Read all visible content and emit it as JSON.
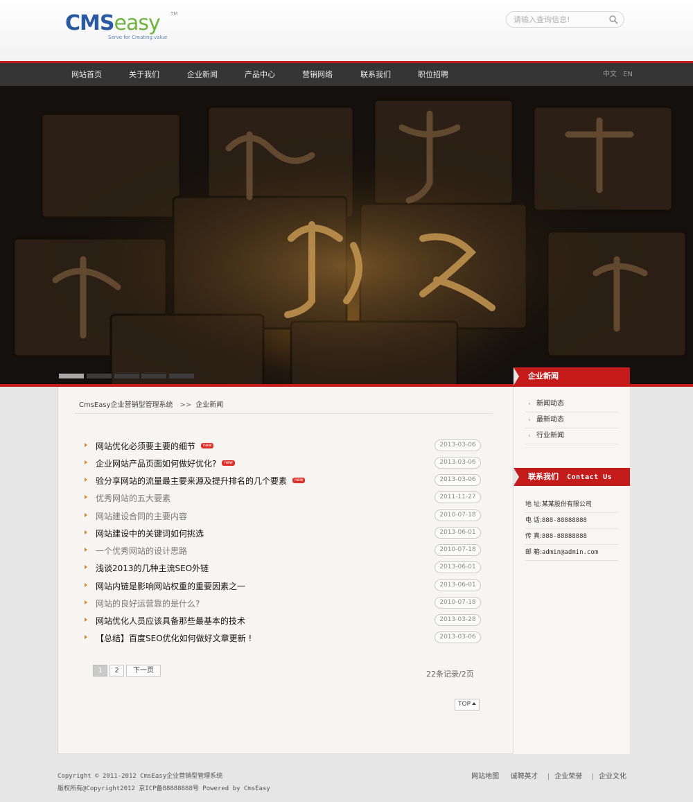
{
  "logo": {
    "cms": "CMS",
    "easy": "easy",
    "tm": "TM",
    "tagline": "Serve for Creating value"
  },
  "search": {
    "placeholder": "请输入查询信息!"
  },
  "nav": {
    "items": [
      "网站首页",
      "关于我们",
      "企业新闻",
      "产品中心",
      "营销网络",
      "联系我们",
      "职位招聘"
    ],
    "lang_cn": "中文",
    "lang_en": "EN"
  },
  "breadcrumb": {
    "site": "CmsEasy企业营销型管理系统",
    "sep": ">>",
    "current": "企业新闻"
  },
  "news": [
    {
      "title": "网站优化必须要主要的细节",
      "date": "2013-03-06",
      "is_new": true,
      "new_label": "new",
      "light": false
    },
    {
      "title": "企业网站产品页面如何做好优化?",
      "date": "2013-03-06",
      "is_new": true,
      "new_label": "new",
      "light": false
    },
    {
      "title": "验分享网站的流量最主要来源及提升排名的几个要素",
      "date": "2013-03-06",
      "is_new": true,
      "new_label": "new",
      "light": false
    },
    {
      "title": "优秀网站的五大要素",
      "date": "2011-11-27",
      "is_new": false,
      "new_label": "",
      "light": true
    },
    {
      "title": "网站建设合同的主要内容",
      "date": "2010-07-18",
      "is_new": false,
      "new_label": "",
      "light": true
    },
    {
      "title": "网站建设中的关键词如何挑选",
      "date": "2013-06-01",
      "is_new": false,
      "new_label": "",
      "light": false
    },
    {
      "title": "一个优秀网站的设计思路",
      "date": "2010-07-18",
      "is_new": false,
      "new_label": "",
      "light": true
    },
    {
      "title": "浅谈2013的几种主流SEO外链",
      "date": "2013-06-01",
      "is_new": false,
      "new_label": "",
      "light": false
    },
    {
      "title": "网站内链是影响网站权重的重要因素之一",
      "date": "2013-06-01",
      "is_new": false,
      "new_label": "",
      "light": false
    },
    {
      "title": "网站的良好运营靠的是什么?",
      "date": "2010-07-18",
      "is_new": false,
      "new_label": "",
      "light": true
    },
    {
      "title": "网站优化人员应该具备那些最基本的技术",
      "date": "2013-03-28",
      "is_new": false,
      "new_label": "",
      "light": false
    },
    {
      "title": "【总结】百度SEO优化如何做好文章更新 !",
      "date": "2013-03-06",
      "is_new": false,
      "new_label": "",
      "light": false
    }
  ],
  "pager": {
    "page1": "1",
    "page2": "2",
    "next": "下一页",
    "records": "22条记录/2页"
  },
  "top_button": "TOP",
  "sidebar": {
    "news_title": "企业新闻",
    "news_items": [
      "新闻动态",
      "最新动态",
      "行业新闻"
    ],
    "contact_title": "联系我们",
    "contact_title_en": "Contact Us",
    "contact": [
      {
        "label": "地 址:",
        "value": "某某股份有限公司"
      },
      {
        "label": "电 话:",
        "value": "888-88888888"
      },
      {
        "label": "传 真:",
        "value": "888-88888888"
      },
      {
        "label": "邮 箱:",
        "value": "admin@admin.com"
      }
    ]
  },
  "footer": {
    "line1": "Copyright © 2011-2012  CmsEasy企业营销型管理系统",
    "line2": "版权所有@Copyright2012 京ICP备88888888号  Powered by  CmsEasy",
    "links": [
      "网站地图",
      "诚聘英才",
      "企业荣誉",
      "企业文化"
    ]
  },
  "colors": {
    "accent": "#c51b1b",
    "nav_bg": "#353535",
    "bullet": "#d68a2a"
  }
}
